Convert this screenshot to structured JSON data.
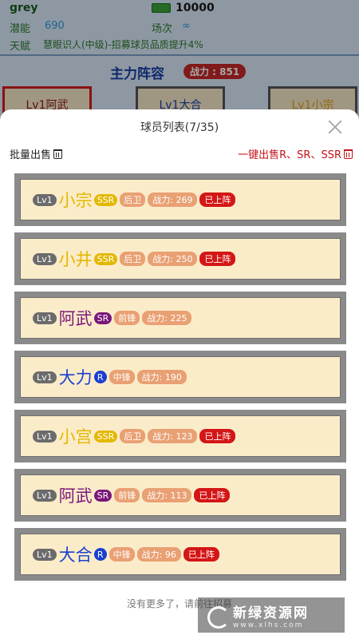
{
  "background": {
    "player_name": "grey",
    "money": "10000",
    "potential_label": "潜能",
    "potential_value": "690",
    "matches_label": "场次",
    "matches_value": "∞",
    "talent_label": "天赋",
    "talent_value": "慧眼识人(中级)-招募球员品质提升4%",
    "lineup_title": "主力阵容",
    "lineup_power": "战力 : 851",
    "slots": [
      "Lv1阿武",
      "Lv1大合",
      "Lv1小宗"
    ]
  },
  "sheet": {
    "title": "球员列表(7/35)",
    "bulk_sell": "批量出售",
    "one_key_sell": "一键出售R、SR、SSR",
    "footer": "没有更多了，请前往招募",
    "players": [
      {
        "lv": "Lv1",
        "name": "小宗",
        "rarity": "SSR",
        "position": "后卫",
        "power": "战力: 269",
        "on_field": "已上阵"
      },
      {
        "lv": "Lv1",
        "name": "小井",
        "rarity": "SSR",
        "position": "后卫",
        "power": "战力: 250",
        "on_field": "已上阵"
      },
      {
        "lv": "Lv1",
        "name": "阿武",
        "rarity": "SR",
        "position": "前锋",
        "power": "战力: 225",
        "on_field": ""
      },
      {
        "lv": "Lv1",
        "name": "大力",
        "rarity": "R",
        "position": "中锋",
        "power": "战力: 190",
        "on_field": ""
      },
      {
        "lv": "Lv1",
        "name": "小宫",
        "rarity": "SSR",
        "position": "后卫",
        "power": "战力: 123",
        "on_field": "已上阵"
      },
      {
        "lv": "Lv1",
        "name": "阿武",
        "rarity": "SR",
        "position": "前锋",
        "power": "战力: 113",
        "on_field": "已上阵"
      },
      {
        "lv": "Lv1",
        "name": "大合",
        "rarity": "R",
        "position": "中锋",
        "power": "战力: 96",
        "on_field": "已上阵"
      }
    ]
  },
  "watermark": {
    "title": "新绿资源网",
    "url": "www.xlhs.com"
  },
  "colors": {
    "ssr": "#e3b800",
    "sr": "#7a177a",
    "r": "#1a3fd0",
    "on_field": "#d41616",
    "sell_red": "#c4121a"
  }
}
